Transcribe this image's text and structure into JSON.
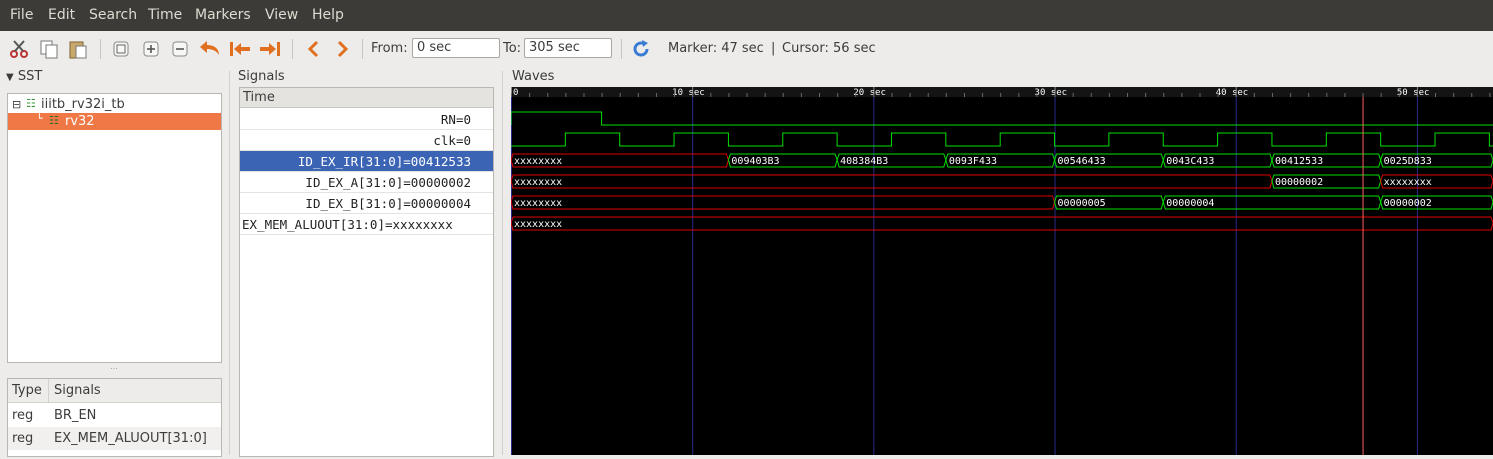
{
  "menu": [
    "File",
    "Edit",
    "Search",
    "Time",
    "Markers",
    "View",
    "Help"
  ],
  "toolbar": {
    "icons": [
      "cut-icon",
      "copy-icon",
      "paste-icon",
      "zoom-fit-icon",
      "zoom-in-icon",
      "zoom-out-icon",
      "undo-zoom-icon",
      "go-start-icon",
      "go-end-icon",
      "prev-icon",
      "next-icon"
    ],
    "from_label": "From:",
    "from_value": "0 sec",
    "to_label": "To:",
    "to_value": "305 sec",
    "reload_icon": "reload-icon",
    "marker_text": "Marker: 47 sec",
    "separator": "|",
    "cursor_text": "Cursor: 56 sec"
  },
  "sst": {
    "title": "SST",
    "tree": [
      {
        "label": "iiitb_rv32i_tb",
        "expanded": true,
        "selected": false
      },
      {
        "label": "rv32",
        "selected": true
      }
    ],
    "table": {
      "headers": [
        "Type",
        "Signals"
      ],
      "rows": [
        {
          "type": "reg",
          "signal": "BR_EN"
        },
        {
          "type": "reg",
          "signal": "EX_MEM_ALUOUT[31:0]"
        }
      ]
    }
  },
  "signals": {
    "title": "Signals",
    "header": "Time",
    "rows": [
      {
        "name": "RN",
        "value": "=0",
        "selected": false
      },
      {
        "name": "clk",
        "value": "=0",
        "selected": false
      },
      {
        "name": "ID_EX_IR[31:0]",
        "value": "=00412533",
        "selected": true
      },
      {
        "name": "ID_EX_A[31:0]",
        "value": "=00000002",
        "selected": false
      },
      {
        "name": "ID_EX_B[31:0]",
        "value": "=00000004",
        "selected": false
      },
      {
        "name": "EX_MEM_ALUOUT[31:0]",
        "value": "=xxxxxxxx",
        "selected": false
      }
    ]
  },
  "waves": {
    "title": "Waves",
    "time_unit": "sec",
    "ruler_labels": [
      "0",
      "10 sec",
      "20 sec",
      "30 sec",
      "40 sec",
      "50 sec"
    ],
    "ruler_ticks": [
      0,
      10,
      20,
      30,
      40,
      50
    ],
    "visible_range": [
      0,
      54.2
    ],
    "marker_time": 47,
    "colors": {
      "background": "#000000",
      "signal": "#00e000",
      "undefined": "#e00000",
      "grid": "#2a2a8a",
      "marker": "#ff5f5f",
      "text": "#ffffff"
    },
    "rn_high_until": 5,
    "clk": {
      "first_rise": 3,
      "high_duration": 3,
      "period": 6
    },
    "buses": [
      {
        "name": "ID_EX_IR[31:0]",
        "segments": [
          {
            "start": 0,
            "end": 12,
            "value": "xxxxxxxx",
            "undefined": true
          },
          {
            "start": 12,
            "end": 18,
            "value": "009403B3"
          },
          {
            "start": 18,
            "end": 24,
            "value": "408384B3"
          },
          {
            "start": 24,
            "end": 30,
            "value": "0093F433"
          },
          {
            "start": 30,
            "end": 36,
            "value": "00546433"
          },
          {
            "start": 36,
            "end": 42,
            "value": "0043C433"
          },
          {
            "start": 42,
            "end": 48,
            "value": "00412533"
          },
          {
            "start": 48,
            "end": 54.2,
            "value": "0025D833"
          }
        ]
      },
      {
        "name": "ID_EX_A[31:0]",
        "segments": [
          {
            "start": 0,
            "end": 42,
            "value": "xxxxxxxx",
            "undefined": true
          },
          {
            "start": 42,
            "end": 48,
            "value": "00000002"
          },
          {
            "start": 48,
            "end": 54.2,
            "value": "xxxxxxxx",
            "undefined": true
          }
        ]
      },
      {
        "name": "ID_EX_B[31:0]",
        "segments": [
          {
            "start": 0,
            "end": 30,
            "value": "xxxxxxxx",
            "undefined": true
          },
          {
            "start": 30,
            "end": 36,
            "value": "00000005"
          },
          {
            "start": 36,
            "end": 48,
            "value": "00000004"
          },
          {
            "start": 48,
            "end": 54.2,
            "value": "00000002"
          }
        ]
      },
      {
        "name": "EX_MEM_ALUOUT[31:0]",
        "segments": [
          {
            "start": 0,
            "end": 54.2,
            "value": "xxxxxxxx",
            "undefined": true
          }
        ]
      }
    ]
  }
}
